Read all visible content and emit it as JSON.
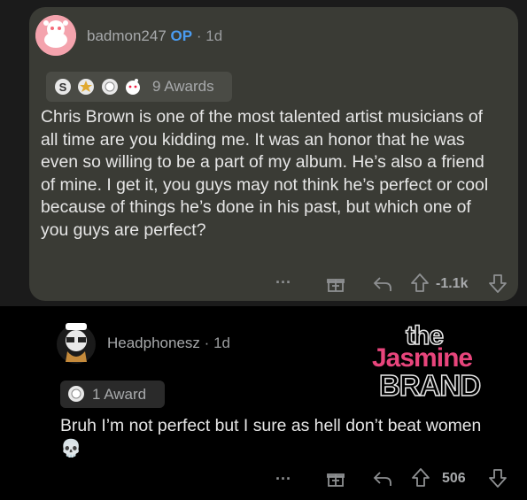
{
  "op_comment": {
    "username": "badmon247",
    "op_label": "OP",
    "separator": "·",
    "time": "1d",
    "awards_label": "9 Awards",
    "body": "Chris Brown is one of the most talented artist musicians of all time are you kidding me. It was an honor that he was even so willing to be a part of my album. He’s also a friend of mine. I get it, you guys may not think he’s perfect or cool because of things he’s done in his past, but which one of you guys are perfect?",
    "score": "-1.1k",
    "more_label": "···"
  },
  "reply_comment": {
    "username": "Headphonesz",
    "separator": "·",
    "time": "1d",
    "awards_label": "1 Award",
    "body": "Bruh I’m not perfect but I sure as hell don’t beat women",
    "emoji": "💀",
    "score": "506",
    "more_label": "···"
  },
  "watermark": {
    "line1": "the",
    "line2": "Jasmine",
    "line3": "BRAND"
  },
  "icons": [
    "snoo-avatar",
    "silver-award-icon",
    "gold-award-icon",
    "wholesome-award-icon",
    "reddit-award-icon",
    "gift-icon",
    "reply-icon",
    "upvote-icon",
    "downvote-icon",
    "skull-icon"
  ],
  "colors": {
    "op_accent": "#4a9bf0",
    "card_bg": "#3a3b35",
    "brand_pink": "#e8457c"
  }
}
